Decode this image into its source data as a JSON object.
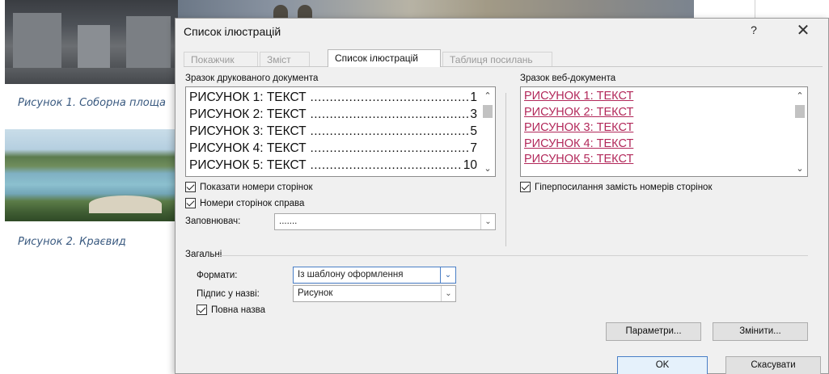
{
  "background_doc": {
    "caption1": "Рисунок 1. Соборна площа",
    "caption2": "Рисунок 2. Краєвид"
  },
  "dialog": {
    "title": "Список ілюстрацій",
    "help": "?",
    "close": "✕",
    "tabs": [
      {
        "label": "Покажчик",
        "active": false
      },
      {
        "label": "Зміст",
        "active": false
      },
      {
        "label": "Список ілюстрацій",
        "active": true
      },
      {
        "label": "Таблиця посилань",
        "active": false
      }
    ],
    "print_preview": {
      "label": "Зразок друкованого документа",
      "entries": [
        {
          "text": "РИСУНОК 1: ТЕКСТ",
          "page": "1"
        },
        {
          "text": "РИСУНОК 2: ТЕКСТ",
          "page": "3"
        },
        {
          "text": "РИСУНОК 3: ТЕКСТ",
          "page": "5"
        },
        {
          "text": "РИСУНОК 4: ТЕКСТ",
          "page": "7"
        },
        {
          "text": "РИСУНОК 5: ТЕКСТ",
          "page": "10"
        }
      ]
    },
    "web_preview": {
      "label": "Зразок веб-документа",
      "entries": [
        "РИСУНОК 1: ТЕКСТ",
        "РИСУНОК 2: ТЕКСТ",
        "РИСУНОК 3: ТЕКСТ",
        "РИСУНОК 4: ТЕКСТ",
        "РИСУНОК 5: ТЕКСТ"
      ]
    },
    "show_page_numbers": {
      "label": "Показати номери сторінок",
      "checked": true
    },
    "right_align_page_numbers": {
      "label": "Номери сторінок справа",
      "checked": true
    },
    "tab_leader": {
      "label": "Заповнювач:",
      "value": "......."
    },
    "hyperlinks_instead": {
      "label": "Гіперпосилання замість номерів сторінок",
      "checked": true
    },
    "general": {
      "label": "Загальні",
      "formats": {
        "label": "Формати:",
        "value": "Із шаблону оформлення"
      },
      "caption_label": {
        "label": "Підпис у назві:",
        "value": "Рисунок"
      },
      "full_name": {
        "label": "Повна назва",
        "checked": true
      }
    },
    "buttons": {
      "options": "Параметри...",
      "modify": "Змінити...",
      "ok": "OK",
      "cancel": "Скасувати"
    },
    "colors": {
      "hyperlink": "#b2285a",
      "focus": "#4a7fc7"
    }
  }
}
